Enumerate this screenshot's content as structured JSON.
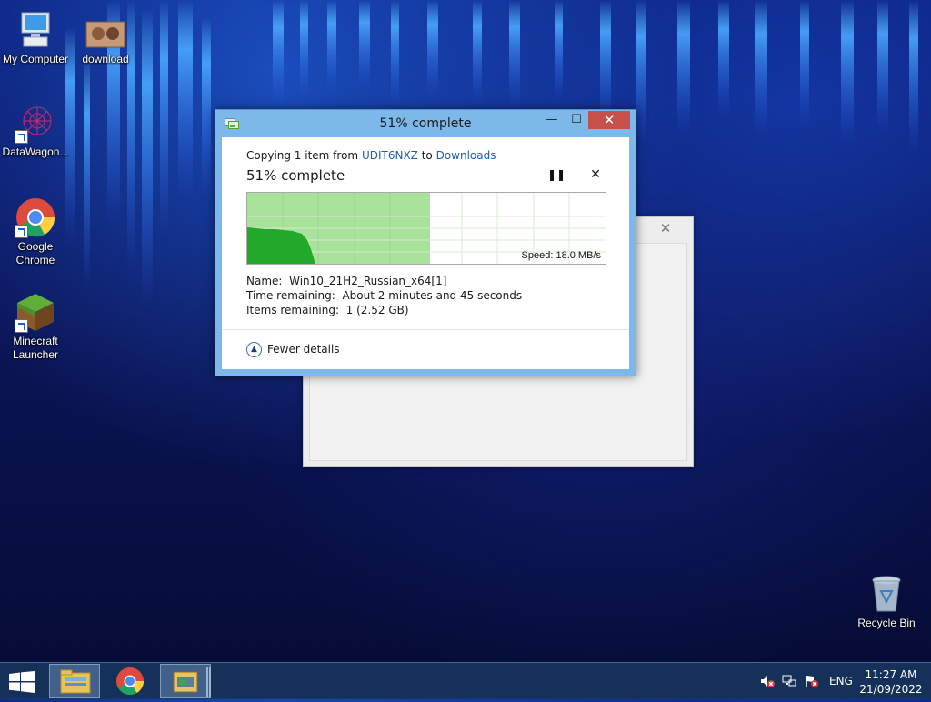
{
  "desktop": {
    "icons": [
      {
        "label": "My Computer",
        "icon": "computer-icon"
      },
      {
        "label": "download",
        "icon": "image-file-icon"
      },
      {
        "label": "DataWagon...",
        "icon": "datawagon-icon"
      },
      {
        "label": "Google Chrome",
        "icon": "chrome-icon"
      },
      {
        "label": "Minecraft Launcher",
        "icon": "minecraft-icon"
      },
      {
        "label": "Recycle Bin",
        "icon": "recycle-bin-icon"
      }
    ]
  },
  "dialog": {
    "title": "51% complete",
    "copy_prefix": "Copying 1 item from ",
    "source": "UDIT6NXZ",
    "copy_mid": " to ",
    "destination": "Downloads",
    "status": "51% complete",
    "progress_fraction": 0.51,
    "speed": "Speed: 18.0 MB/s",
    "details": {
      "name_label": "Name:",
      "name_value": "Win10_21H2_Russian_x64[1]",
      "time_label": "Time remaining:",
      "time_value": "About 2 minutes and 45 seconds",
      "items_label": "Items remaining:",
      "items_value": "1 (2.52 GB)"
    },
    "fewer_details": "Fewer details",
    "accent_color": "#7cb8ea",
    "close_color": "#c7504a",
    "progress_color": "#a9e29b"
  },
  "taskbar": {
    "items": [
      "File Explorer",
      "Google Chrome",
      "File copy"
    ],
    "language": "ENG",
    "time": "11:27 AM",
    "date": "21/09/2022"
  }
}
